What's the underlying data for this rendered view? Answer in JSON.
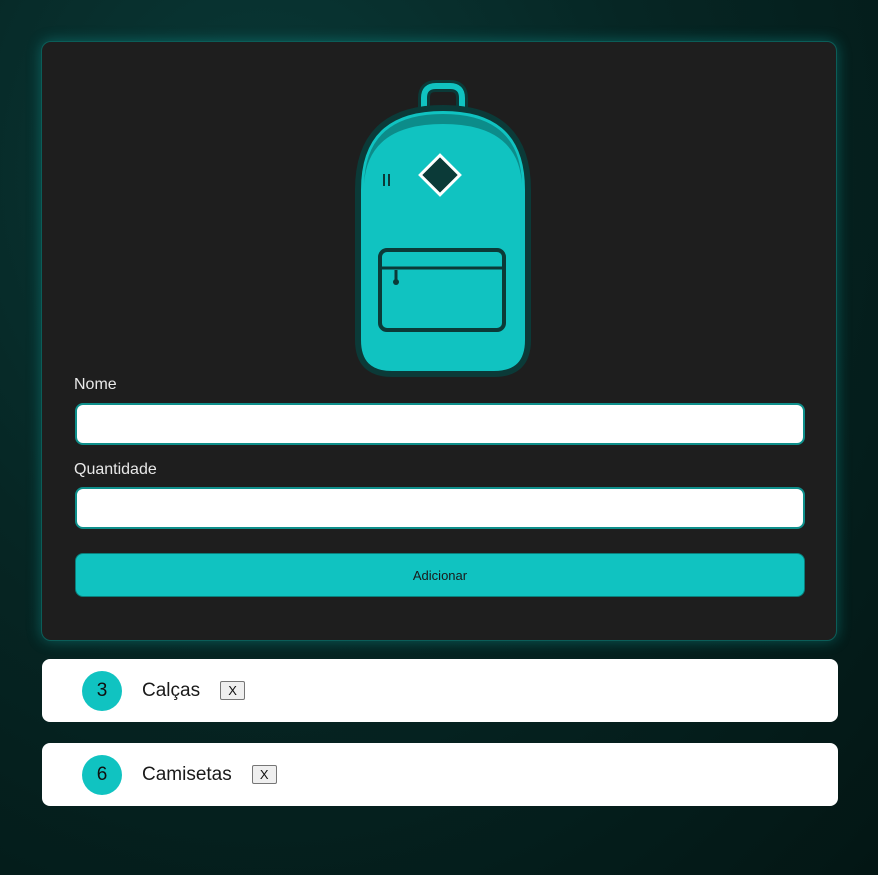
{
  "form": {
    "name_label": "Nome",
    "name_value": "",
    "quantity_label": "Quantidade",
    "quantity_value": "",
    "add_button_label": "Adicionar"
  },
  "items": [
    {
      "quantity": "3",
      "name": "Calças",
      "remove_label": "X"
    },
    {
      "quantity": "6",
      "name": "Camisetas",
      "remove_label": "X"
    }
  ],
  "colors": {
    "accent": "#10c3c1",
    "card_background": "#1e1e1e",
    "page_background": "#062624"
  },
  "icons": {
    "illustration": "backpack-icon"
  }
}
